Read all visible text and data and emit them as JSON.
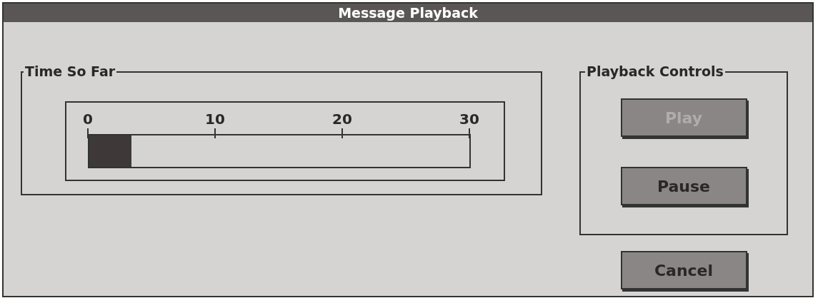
{
  "window": {
    "title": "Message Playback"
  },
  "time_group": {
    "label": "Time So Far",
    "scale": [
      "0",
      "10",
      "20",
      "30"
    ],
    "meter": {
      "level": 0.11
    }
  },
  "controls_group": {
    "label": "Playback Controls",
    "buttons": [
      {
        "label": "Play",
        "disabled": true
      },
      {
        "label": "Pause",
        "disabled": false
      }
    ]
  },
  "cancel_button": {
    "label": "Cancel",
    "disabled": false
  }
}
